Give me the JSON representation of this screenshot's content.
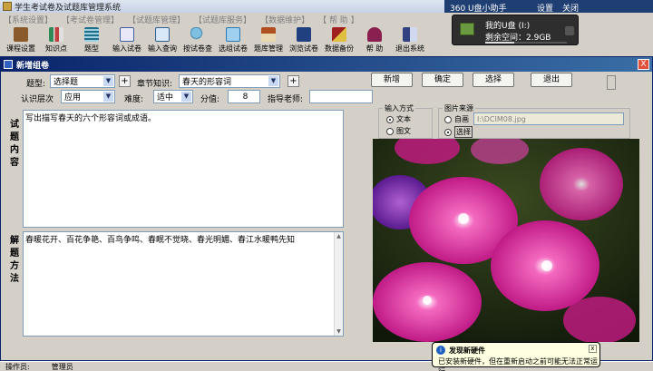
{
  "app": {
    "title": "学生考试卷及试题库管理系统"
  },
  "menu": [
    "【系统设置】",
    "【考试卷管理】",
    "【试题库管理】",
    "【试题库服务】",
    "【数据维护】",
    "【 帮 助 】"
  ],
  "toolbar": [
    {
      "label": "课程设置",
      "icon": "course-settings-icon",
      "color": "#8a5a2a"
    },
    {
      "label": "知识点",
      "icon": "knowledge-chart-icon",
      "color": "#2e8b57"
    },
    {
      "label": "题型",
      "icon": "question-type-icon",
      "color": "#1f6f8b"
    },
    {
      "label": "输入试卷",
      "icon": "input-paper-icon",
      "color": "#4060a0"
    },
    {
      "label": "输入查询",
      "icon": "input-query-icon",
      "color": "#306090"
    },
    {
      "label": "按试卷查",
      "icon": "search-paper-icon",
      "color": "#3080b0"
    },
    {
      "label": "选组试卷",
      "icon": "compose-paper-icon",
      "color": "#2f7ab0"
    },
    {
      "label": "题库管理",
      "icon": "home-icon",
      "color": "#b05020"
    },
    {
      "label": "浏览试卷",
      "icon": "browse-paper-icon",
      "color": "#204080"
    },
    {
      "label": "数据备份",
      "icon": "backup-icon",
      "color": "#a02020"
    },
    {
      "label": "帮 助",
      "icon": "help-icon",
      "color": "#8a2050"
    },
    {
      "label": "退出系统",
      "icon": "exit-icon",
      "color": "#304080"
    }
  ],
  "overlay": {
    "helper": "360 U盘小助手",
    "settings": "设置",
    "close": "关闭",
    "usb_name": "我的U盘 (I:)",
    "usb_space": "剩余空间：2.9GB",
    "usb_fill": 0.35
  },
  "dialog": {
    "title": "新增组卷",
    "close": "X",
    "type_label": "题型:",
    "type_value": "选择题",
    "chapter_label": "章节知识:",
    "chapter_value": "春天的形容词",
    "level_label": "认识层次",
    "level_value": "应用",
    "difficulty_label": "难度:",
    "difficulty_value": "适中",
    "score_label": "分值:",
    "score_value": "8",
    "teacher_label": "指导老师:",
    "teacher_value": "",
    "plus": "+",
    "question_side_label": "试题内容",
    "question_text": "写出描写春天的六个形容词或成语。",
    "answer_side_label": "解题方法",
    "answer_text": "春暖花开、百花争艳、百鸟争鸣、春眠不觉晓、春光明媚、春江水暖鸭先知",
    "buttons": {
      "add": "新增",
      "confirm": "确定",
      "select": "选择",
      "exit": "退出"
    },
    "input_mode": {
      "title": "输入方式",
      "text": "文本",
      "image_text": "图文",
      "selected": "text"
    },
    "image_source": {
      "title": "图片来源",
      "auto": "自画",
      "select": "选择",
      "selected": "select",
      "path": "I:\\DCIM08.jpg"
    }
  },
  "statusbar": {
    "operator_label": "操作员:",
    "operator_value": "管理员"
  },
  "balloon": {
    "title": "发现新硬件",
    "body": "已安装新硬件，但在重新启动之前可能无法正常运行。",
    "close": "x"
  }
}
